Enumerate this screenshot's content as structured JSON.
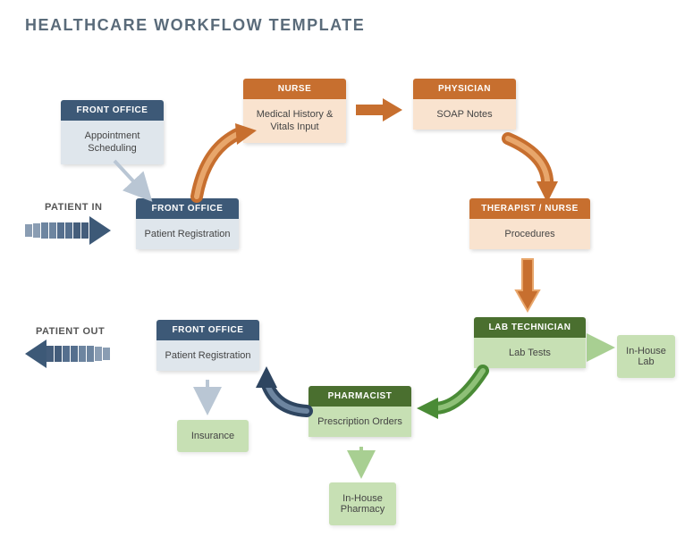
{
  "title": "HEALTHCARE WORKFLOW TEMPLATE",
  "labels": {
    "patientIn": "PATIENT IN",
    "patientOut": "PATIENT OUT"
  },
  "nodes": {
    "appt": {
      "header": "FRONT OFFICE",
      "body": "Appointment Scheduling"
    },
    "reg1": {
      "header": "FRONT OFFICE",
      "body": "Patient Registration"
    },
    "nurse": {
      "header": "NURSE",
      "body": "Medical History & Vitals Input"
    },
    "physician": {
      "header": "PHYSICIAN",
      "body": "SOAP Notes"
    },
    "therapist": {
      "header": "THERAPIST / NURSE",
      "body": "Procedures"
    },
    "lab": {
      "header": "LAB TECHNICIAN",
      "body": "Lab Tests"
    },
    "pharmacist": {
      "header": "PHARMACIST",
      "body": "Prescription Orders"
    },
    "reg2": {
      "header": "FRONT OFFICE",
      "body": "Patient Registration"
    }
  },
  "aux": {
    "insurance": "Insurance",
    "inhouseLab": "In-House Lab",
    "inhousePharmacy": "In-House Pharmacy"
  }
}
